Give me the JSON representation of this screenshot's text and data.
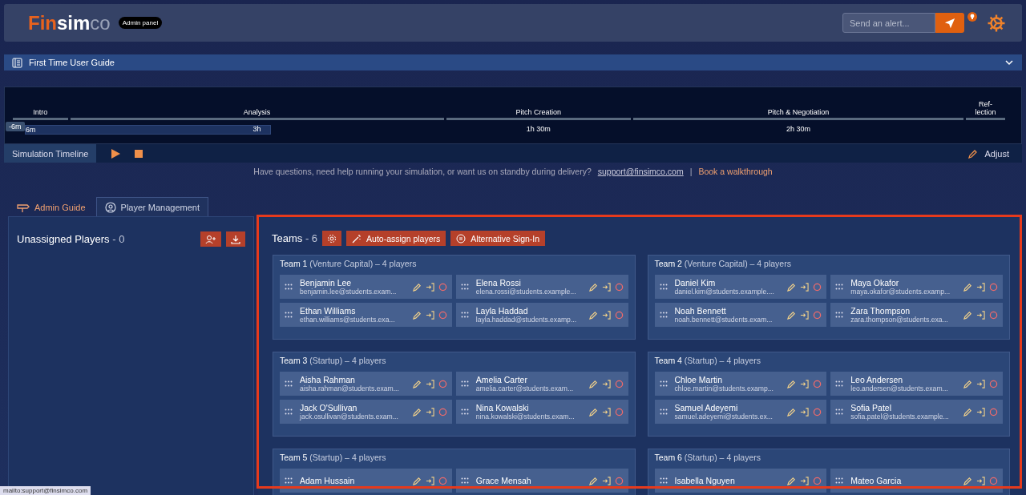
{
  "header": {
    "logo": {
      "part_1": "Fin",
      "part_2": "sim",
      "part_3": "co"
    },
    "badge": "Admin panel",
    "alert": {
      "placeholder": "Send an alert..."
    }
  },
  "guide_bar": {
    "title": "First Time User Guide",
    "expanded": false
  },
  "timeline": {
    "offset": "-6m",
    "phases": [
      {
        "name": "Intro",
        "duration": "6m"
      },
      {
        "name": "Analysis",
        "duration": "3h"
      },
      {
        "name": "Pitch Creation",
        "duration": "1h 30m"
      },
      {
        "name": "Pitch & Negotiation",
        "duration": "2h 30m"
      },
      {
        "name": "Ref-\nlection"
      }
    ],
    "label": "Simulation Timeline",
    "adjust": "Adjust"
  },
  "help": {
    "text": "Have questions, need help running your simulation, or want us on standby during delivery?",
    "email": "support@finsimco.com",
    "separator": "|",
    "walkthrough": "Book a walkthrough"
  },
  "tabs": [
    {
      "label": "Admin Guide",
      "selected": false
    },
    {
      "label": "Player Management",
      "selected": true
    }
  ],
  "unassigned": {
    "title": "Unassigned Players",
    "count": "- 0"
  },
  "teams": {
    "title": "Teams",
    "count": "- 6",
    "auto_assign": "Auto-assign players",
    "alt_sign_in": "Alternative Sign-In",
    "list": [
      {
        "name": "Team 1",
        "type": "(Venture Capital)",
        "players_count": "– 4 players",
        "players": [
          {
            "name": "Benjamin Lee",
            "email": "benjamin.lee@students.exam..."
          },
          {
            "name": "Elena Rossi",
            "email": "elena.rossi@students.example..."
          },
          {
            "name": "Ethan Williams",
            "email": "ethan.williams@students.exa..."
          },
          {
            "name": "Layla Haddad",
            "email": "layla.haddad@students.examp..."
          }
        ]
      },
      {
        "name": "Team 2",
        "type": "(Venture Capital)",
        "players_count": "– 4 players",
        "players": [
          {
            "name": "Daniel Kim",
            "email": "daniel.kim@students.example...."
          },
          {
            "name": "Maya Okafor",
            "email": "maya.okafor@students.examp..."
          },
          {
            "name": "Noah Bennett",
            "email": "noah.bennett@students.exam..."
          },
          {
            "name": "Zara Thompson",
            "email": "zara.thompson@students.exa..."
          }
        ]
      },
      {
        "name": "Team 3",
        "type": "(Startup)",
        "players_count": "– 4 players",
        "players": [
          {
            "name": "Aisha Rahman",
            "email": "aisha.rahman@students.exam..."
          },
          {
            "name": "Amelia Carter",
            "email": "amelia.carter@students.exam..."
          },
          {
            "name": "Jack O'Sullivan",
            "email": "jack.osullivan@students.exam..."
          },
          {
            "name": "Nina Kowalski",
            "email": "nina.kowalski@students.exam..."
          }
        ]
      },
      {
        "name": "Team 4",
        "type": "(Startup)",
        "players_count": "– 4 players",
        "players": [
          {
            "name": "Chloe Martin",
            "email": "chloe.martin@students.examp..."
          },
          {
            "name": "Leo Andersen",
            "email": "leo.andersen@students.exam..."
          },
          {
            "name": "Samuel Adeyemi",
            "email": "samuel.adeyemi@students.ex..."
          },
          {
            "name": "Sofia Patel",
            "email": "sofia.patel@students.example..."
          }
        ]
      },
      {
        "name": "Team 5",
        "type": "(Startup)",
        "players_count": "– 4 players",
        "players": [
          {
            "name": "Adam Hussain"
          },
          {
            "name": "Grace Mensah"
          }
        ]
      },
      {
        "name": "Team 6",
        "type": "(Startup)",
        "players_count": "– 4 players",
        "players": [
          {
            "name": "Isabella Nguyen"
          },
          {
            "name": "Mateo Garcia"
          }
        ]
      }
    ]
  },
  "status_bar": {
    "link_preview": "mailto:support@finsimco.com"
  }
}
